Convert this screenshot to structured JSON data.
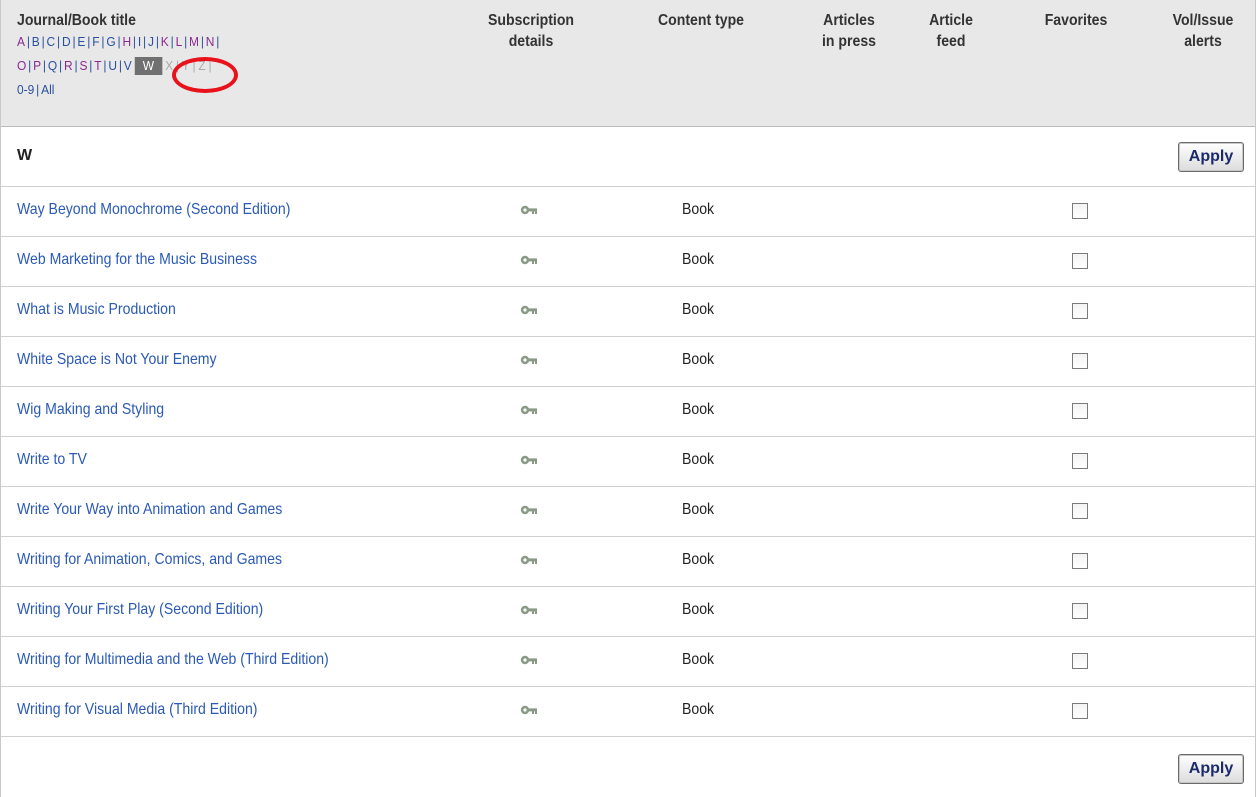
{
  "header": {
    "title_col": "Journal/Book title",
    "subscription_col": [
      "Subscription",
      "details"
    ],
    "content_type_col": "Content type",
    "articles_in_press_col": [
      "Articles",
      "in press"
    ],
    "article_feed_col": [
      "Article",
      "feed"
    ],
    "favorites_col": "Favorites",
    "alerts_col": [
      "Vol/Issue",
      "alerts"
    ]
  },
  "alphabet": {
    "row1": [
      "A",
      "B",
      "C",
      "D",
      "E",
      "F",
      "G",
      "H",
      "I",
      "J",
      "K",
      "L",
      "M",
      "N"
    ],
    "row2_links": [
      "O",
      "P",
      "Q",
      "R",
      "S",
      "T",
      "U",
      "V"
    ],
    "current": "W",
    "row2_disabled": [
      "X",
      "Y",
      "Z"
    ],
    "numbers": "0-9",
    "all": "All"
  },
  "section": {
    "letter": "W",
    "apply_label": "Apply"
  },
  "rows": [
    {
      "title": "Way Beyond Monochrome (Second Edition)",
      "content_type": "Book"
    },
    {
      "title": "Web Marketing for the Music Business",
      "content_type": "Book"
    },
    {
      "title": "What is Music Production",
      "content_type": "Book"
    },
    {
      "title": "White Space is Not Your Enemy",
      "content_type": "Book"
    },
    {
      "title": "Wig Making and Styling",
      "content_type": "Book"
    },
    {
      "title": "Write to TV",
      "content_type": "Book"
    },
    {
      "title": "Write Your Way into Animation and Games",
      "content_type": "Book"
    },
    {
      "title": "Writing for Animation, Comics, and Games",
      "content_type": "Book"
    },
    {
      "title": "Writing Your First Play (Second Edition)",
      "content_type": "Book"
    },
    {
      "title": "Writing for Multimedia and the Web (Third Edition)",
      "content_type": "Book"
    },
    {
      "title": "Writing for Visual Media (Third Edition)",
      "content_type": "Book"
    }
  ],
  "footer": {
    "apply_label": "Apply"
  },
  "colors": {
    "link": "#2a59b6",
    "highlight_ring": "#e8121b",
    "current_letter_bg": "#707070"
  },
  "icons": {
    "subscription": "key-icon"
  }
}
